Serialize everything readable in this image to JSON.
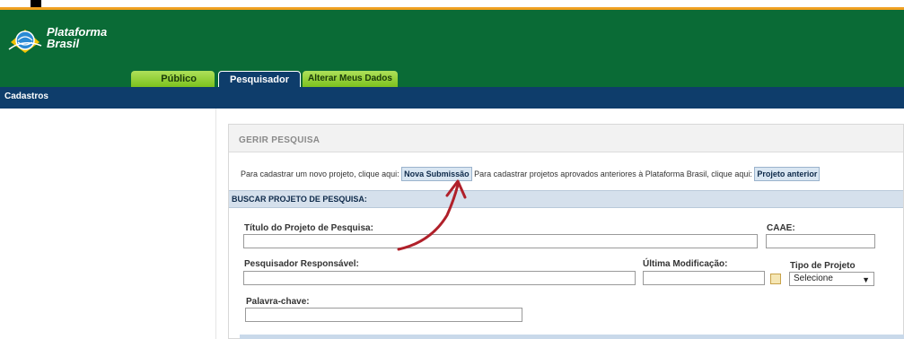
{
  "brand": {
    "line1": "Plataforma",
    "line2": "Brasil"
  },
  "tabs": [
    {
      "label": "Público"
    },
    {
      "label": "Pesquisador"
    },
    {
      "label": "Alterar Meus Dados"
    }
  ],
  "nav": {
    "item": "Cadastros"
  },
  "panel": {
    "title": "GERIR PESQUISA",
    "info_text_1": "Para cadastrar um novo projeto, clique aqui:",
    "new_submission_button": "Nova Submissão",
    "info_text_2": "Para cadastrar projetos aprovados anteriores à Plataforma Brasil, clique aqui:",
    "previous_project_button": "Projeto anterior",
    "search_section_title": "BUSCAR PROJETO DE PESQUISA:",
    "fields": {
      "titulo_label": "Título do Projeto de Pesquisa:",
      "caae_label": "CAAE:",
      "pesquisador_label": "Pesquisador Responsável:",
      "ultima_mod_label": "Última Modificação:",
      "tipo_label": "Tipo de Projeto",
      "tipo_selected": "Selecione",
      "palavra_label": "Palavra-chave:"
    }
  },
  "colors": {
    "header_green": "#0a6b36",
    "nav_blue": "#0e3d6b",
    "tab_green": "#8ccf2e",
    "accent_orange": "#f0a020",
    "arrow_red": "#b0202a"
  }
}
